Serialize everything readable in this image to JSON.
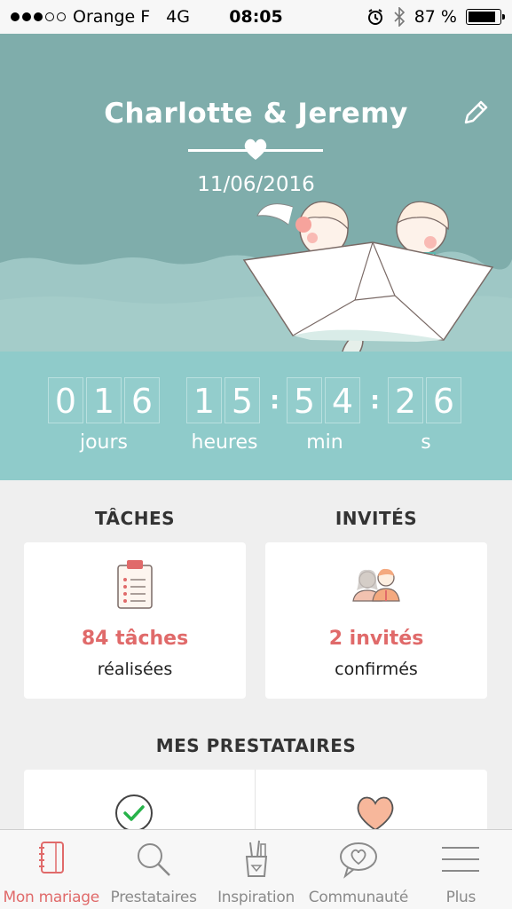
{
  "status_bar": {
    "carrier": "Orange F",
    "network": "4G",
    "time": "08:05",
    "battery": "87 %",
    "battery_level": 0.87
  },
  "hero": {
    "couple_names": "Charlotte & Jeremy",
    "wedding_date": "11/06/2016",
    "edit_icon": "pencil-icon"
  },
  "countdown": {
    "days_digits": [
      "0",
      "1",
      "6"
    ],
    "hours_digits": [
      "1",
      "5"
    ],
    "minutes_digits": [
      "5",
      "4"
    ],
    "seconds_digits": [
      "2",
      "6"
    ],
    "separator": ":",
    "days_label": "jours",
    "hours_label": "heures",
    "minutes_label": "min",
    "seconds_label": "s"
  },
  "tasks": {
    "title": "TÂCHES",
    "value": "84 tâches",
    "sub": "réalisées",
    "icon": "clipboard-icon"
  },
  "guests": {
    "title": "INVITÉS",
    "value": "2 invités",
    "sub": "confirmés",
    "icon": "couple-icon"
  },
  "vendors": {
    "title": "MES PRESTATAIRES",
    "left_icon": "check-circle-icon",
    "right_icon": "heart-icon"
  },
  "tabbar": {
    "items": [
      {
        "label": "Mon mariage",
        "icon": "notebook-icon",
        "active": true
      },
      {
        "label": "Prestataires",
        "icon": "search-icon",
        "active": false
      },
      {
        "label": "Inspiration",
        "icon": "pencil-cup-icon",
        "active": false
      },
      {
        "label": "Communauté",
        "icon": "chat-heart-icon",
        "active": false
      },
      {
        "label": "Plus",
        "icon": "menu-icon",
        "active": false
      }
    ]
  },
  "colors": {
    "hero_bg": "#7fadab",
    "countdown_bg": "#8fcbca",
    "accent": "#e06a6a",
    "page_bg": "#efefef"
  }
}
